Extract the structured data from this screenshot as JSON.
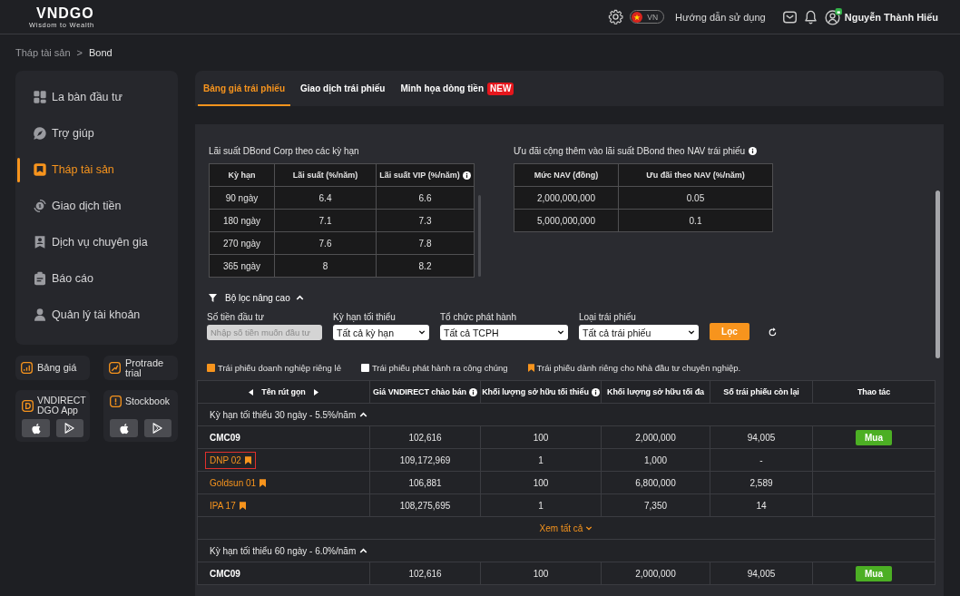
{
  "header": {
    "logo": "VNDGO",
    "tagline": "Wisdom to Wealth",
    "language": "VN",
    "help": "Hướng dẫn sử dụng",
    "user_name": "Nguyễn Thành Hiếu"
  },
  "breadcrumb": {
    "items": [
      "Tháp tài sản",
      "Bond"
    ],
    "separator": ">"
  },
  "sidebar": {
    "items": [
      {
        "label": "La bàn đầu tư",
        "selected": false
      },
      {
        "label": "Trợ giúp",
        "selected": false
      },
      {
        "label": "Tháp tài sản",
        "selected": true
      },
      {
        "label": "Giao dịch tiền",
        "selected": false
      },
      {
        "label": "Dịch vụ chuyên gia",
        "selected": false
      },
      {
        "label": "Báo cáo",
        "selected": false
      },
      {
        "label": "Quản lý tài khoản",
        "selected": false
      }
    ],
    "quick_links": [
      "Bảng giá",
      "Protrade trial"
    ],
    "apps": [
      "VNDIRECT DGO App",
      "Stockbook"
    ]
  },
  "tabs": [
    {
      "label": "Bảng giá trái phiếu",
      "selected": true
    },
    {
      "label": "Giao dịch trái phiếu",
      "selected": false
    },
    {
      "label": "Minh họa dòng tiền",
      "selected": false,
      "badge": "NEW"
    }
  ],
  "rates_table": {
    "title": "Lãi suất DBond Corp theo các kỳ hạn",
    "columns": [
      {
        "label": "Kỳ hạn",
        "info": false
      },
      {
        "label": "Lãi suất (%/năm)",
        "info": false
      },
      {
        "label": "Lãi suất VIP (%/năm)",
        "info": true
      }
    ],
    "rows": [
      [
        "90 ngày",
        "6.4",
        "6.6"
      ],
      [
        "180 ngày",
        "7.1",
        "7.3"
      ],
      [
        "270 ngày",
        "7.6",
        "7.8"
      ],
      [
        "365 ngày",
        "8",
        "8.2"
      ]
    ]
  },
  "nav_table": {
    "title": "Ưu đãi cộng thêm vào lãi suất DBond theo NAV trái phiếu",
    "info": true,
    "columns": [
      {
        "label": "Mức NAV (đồng)",
        "info": false
      },
      {
        "label": "Ưu đãi theo NAV (%/năm)",
        "info": false
      }
    ],
    "rows": [
      [
        "2,000,000,000",
        "0.05"
      ],
      [
        "5,000,000,000",
        "0.1"
      ]
    ]
  },
  "filter": {
    "title": "Bộ lọc nâng cao",
    "expanded": true,
    "fields": [
      {
        "kind": "input",
        "label": "Số tiền đầu tư",
        "placeholder": "Nhập số tiền muốn đầu tư"
      },
      {
        "kind": "select",
        "label": "Kỳ hạn tối thiểu",
        "value": "Tất cả kỳ hạn"
      },
      {
        "kind": "select",
        "label": "Tổ chức phát hành",
        "value": "Tất cả TCPH"
      },
      {
        "kind": "select",
        "label": "Loại trái phiếu",
        "value": "Tất cả trái phiếu"
      }
    ],
    "submit": "Lọc"
  },
  "legend": [
    {
      "kind": "square",
      "label": "Trái phiếu doanh nghiệp riêng lẻ",
      "color": "#f7941d"
    },
    {
      "kind": "square",
      "label": "Trái phiếu phát hành ra công chúng",
      "color": "#ffffff"
    },
    {
      "kind": "bookmark",
      "label": "Trái phiếu dành riêng cho Nhà đầu tư chuyên nghiệp.",
      "color": "#f7941d"
    }
  ],
  "bond_table": {
    "columns": [
      {
        "label": "Tên rút gọn",
        "info": false,
        "scroll_arrows": true
      },
      {
        "label": "Giá VNDIRECT chào bán",
        "info": true,
        "scroll_arrows": false
      },
      {
        "label": "Khối lượng sở hữu tối thiểu",
        "info": true,
        "scroll_arrows": false
      },
      {
        "label": "Khối lượng sở hữu tối đa",
        "info": false,
        "scroll_arrows": false
      },
      {
        "label": "Số trái phiếu còn lại",
        "info": false,
        "scroll_arrows": false
      },
      {
        "label": "Thao tác",
        "info": false,
        "scroll_arrows": false
      }
    ],
    "groups": [
      {
        "title": "Kỳ hạn tối thiểu 30 ngày - 5.5%/năm",
        "expanded": true,
        "rows": [
          {
            "name": "CMC09",
            "kind": "public",
            "professional": false,
            "highlighted": false,
            "price": "102,616",
            "min_holding": "100",
            "max_holding": "2,000,000",
            "remaining": "94,005",
            "action": "Mua"
          },
          {
            "name": "DNP 02",
            "kind": "private",
            "professional": true,
            "highlighted": true,
            "price": "109,172,969",
            "min_holding": "1",
            "max_holding": "1,000",
            "remaining": "-"
          },
          {
            "name": "Goldsun 01",
            "kind": "private",
            "professional": true,
            "highlighted": false,
            "price": "106,881",
            "min_holding": "100",
            "max_holding": "6,800,000",
            "remaining": "2,589"
          },
          {
            "name": "IPA 17",
            "kind": "private",
            "professional": true,
            "highlighted": false,
            "price": "108,275,695",
            "min_holding": "1",
            "max_holding": "7,350",
            "remaining": "14"
          }
        ],
        "view_all": "Xem tất cả"
      },
      {
        "title": "Kỳ hạn tối thiểu 60 ngày - 6.0%/năm",
        "expanded": true,
        "rows": [
          {
            "name": "CMC09",
            "kind": "public",
            "professional": false,
            "highlighted": false,
            "price": "102,616",
            "min_holding": "100",
            "max_holding": "2,000,000",
            "remaining": "94,005",
            "action": "Mua"
          }
        ]
      }
    ]
  }
}
